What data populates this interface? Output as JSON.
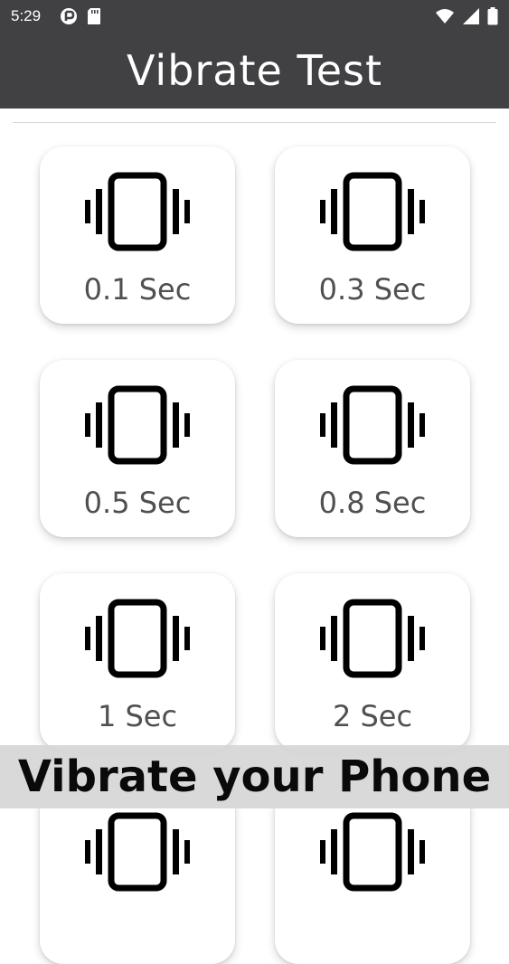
{
  "status_bar": {
    "time": "5:29",
    "left_icons": [
      "notification-app-icon",
      "sd-card-icon"
    ],
    "right_icons": [
      "wifi-icon",
      "cellular-signal-icon",
      "battery-icon"
    ]
  },
  "app_bar": {
    "title": "Vibrate Test"
  },
  "tiles": [
    {
      "label": "0.1 Sec",
      "icon": "vibration-icon"
    },
    {
      "label": "0.3 Sec",
      "icon": "vibration-icon"
    },
    {
      "label": "0.5 Sec",
      "icon": "vibration-icon"
    },
    {
      "label": "0.8 Sec",
      "icon": "vibration-icon"
    },
    {
      "label": "1 Sec",
      "icon": "vibration-icon"
    },
    {
      "label": "2 Sec",
      "icon": "vibration-icon"
    },
    {
      "label": "",
      "icon": "vibration-icon"
    },
    {
      "label": "",
      "icon": "vibration-icon"
    }
  ],
  "banner": {
    "text": "Vibrate your Phone"
  },
  "colors": {
    "app_bar": "#414042",
    "tile_label": "#505050",
    "banner_background": "#d6d6d6",
    "icon": "#000000"
  }
}
